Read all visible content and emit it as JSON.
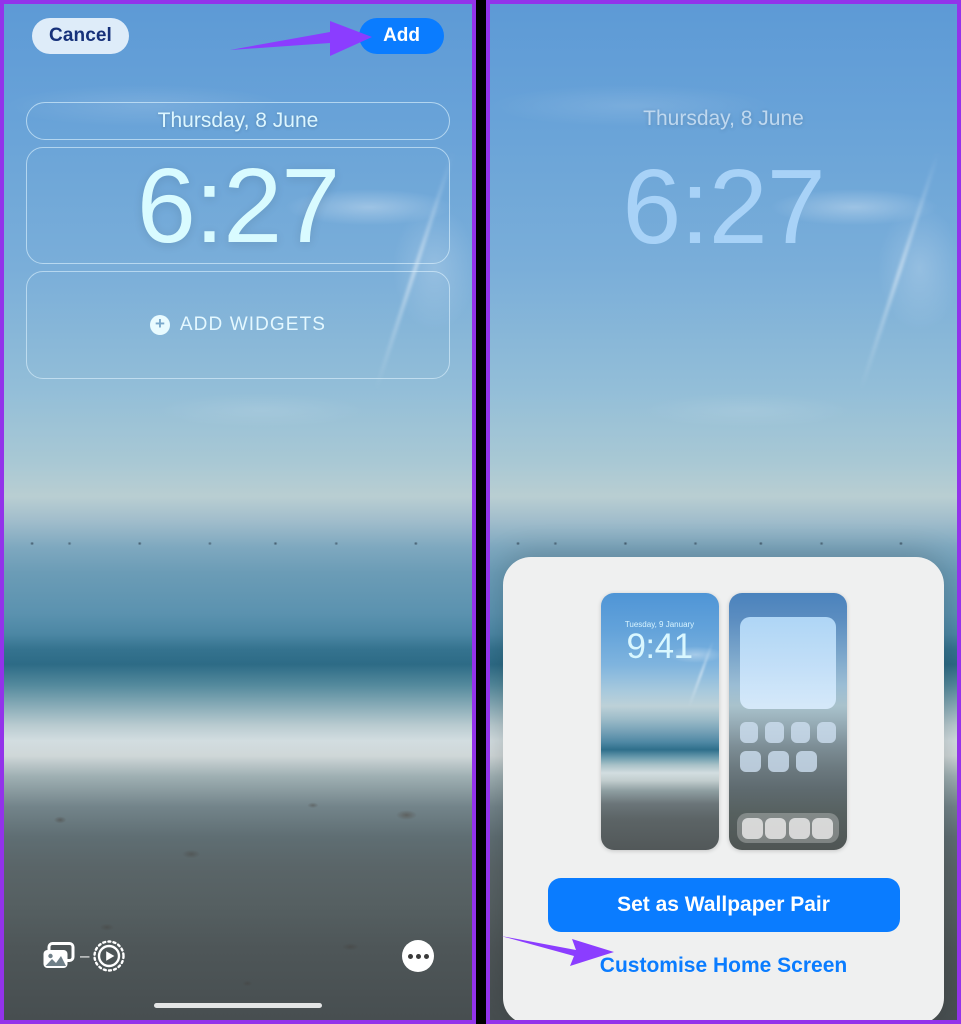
{
  "accent_color": "#9333ea",
  "ios_blue": "#0a7cff",
  "left_panel": {
    "name": "lock-screen-editor",
    "toolbar": {
      "cancel_label": "Cancel",
      "add_label": "Add"
    },
    "date_label": "Thursday, 8 June",
    "time_label": "6:27",
    "widget_placeholder": {
      "plus_glyph": "+",
      "label": "ADD WIDGETS"
    },
    "bottom_tools": {
      "photo_shuffle_icon": "photo-stack-icon",
      "separator": "–",
      "live_photo_icon": "live-photo-play-icon",
      "more_icon": "more-ellipsis-icon"
    },
    "annotation_arrow": "arrow-pointing-to-add-button"
  },
  "right_panel": {
    "name": "wallpaper-pair-confirmation",
    "date_label": "Thursday, 8 June",
    "time_label": "6:27",
    "sheet": {
      "lock_preview": {
        "name": "lock-screen-preview",
        "date_label": "Tuesday, 9 January",
        "time_label": "9:41"
      },
      "home_preview": {
        "name": "home-screen-preview",
        "widget": "large-widget",
        "row1_icons": 4,
        "row2_icons": 3,
        "dock_icons": 4
      },
      "primary_button_label": "Set as Wallpaper Pair",
      "secondary_link_label": "Customise Home Screen"
    },
    "annotation_arrow": "arrow-pointing-to-customise-home-screen"
  }
}
